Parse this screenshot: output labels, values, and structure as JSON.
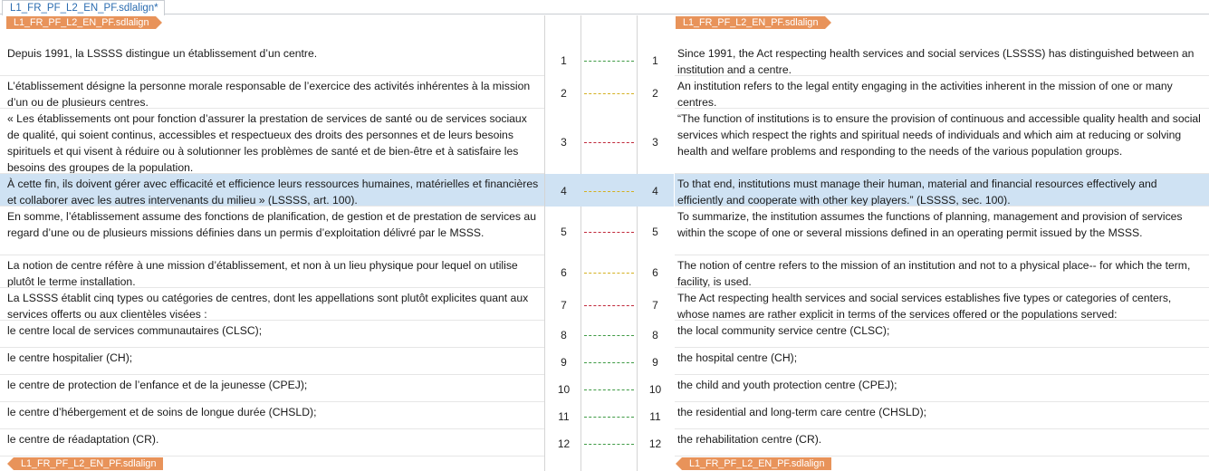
{
  "tab": {
    "label": "L1_FR_PF_L2_EN_PF.sdlalign*"
  },
  "files": {
    "source": "L1_FR_PF_L2_EN_PF.sdlalign",
    "target": "L1_FR_PF_L2_EN_PF.sdlalign"
  },
  "colors": {
    "green": "#3e9a44",
    "yellow": "#d4b020",
    "red": "#c0283a",
    "tag": "#e8935a",
    "selected": "#cfe2f3"
  },
  "segments": [
    {
      "n": "1",
      "quality": "green",
      "src": "Depuis 1991, la LSSSS distingue un établissement d’un centre.",
      "tgt": "Since 1991, the Act respecting health services and social services (LSSSS) has distinguished between an institution and a centre."
    },
    {
      "n": "2",
      "quality": "yellow",
      "src": "L’établissement désigne la personne morale responsable de l’exercice des activités inhérentes à la mission d’un ou de plusieurs centres.",
      "tgt": "An institution refers to the legal entity engaging in the activities inherent in the mission of one or many centres."
    },
    {
      "n": "3",
      "quality": "red",
      "src": "« Les établissements ont pour fonction d’assurer la prestation de services de santé ou de  services sociaux de qualité, qui soient continus, accessibles et respectueux des  droits des personnes et de leurs besoins spirituels et qui visent à réduire ou à solutionner les problèmes de santé et de bien-être et à satisfaire les besoins des groupes de la population.",
      "tgt": "“The function of institutions is to ensure the provision of continuous and accessible quality health and social services which respect the rights and spiritual needs of individuals and which aim at reducing or solving health and welfare problems and responding to the needs of the various population groups."
    },
    {
      "n": "4",
      "quality": "yellow",
      "selected": true,
      "src": "À cette fin, ils doivent gérer avec efficacité et efficience leurs ressources humaines, matérielles et financières et collaborer avec les autres intervenants du milieu » (LSSSS, art. 100).",
      "tgt": "To that end, institutions must manage their human, material and financial resources effectively and efficiently and cooperate with other key players.” (LSSSS, sec. 100)."
    },
    {
      "n": "5",
      "quality": "red",
      "src": "En somme, l’établissement assume des fonctions de planification, de gestion et de prestation de services au regard d’une ou de plusieurs missions définies dans un permis d’exploitation délivré par le MSSS.",
      "tgt": "To summarize, the institution assumes the functions of planning, management and provision of services within the scope of one or several missions defined in an operating permit issued by the MSSS."
    },
    {
      "n": "6",
      "quality": "yellow",
      "src": "La notion de centre réfère à une mission d’établissement, et non à un lieu physique pour lequel on utilise plutôt le terme installation.",
      "tgt": "The notion of centre refers to the mission of an institution and not to a physical place-- for which the term, facility, is used."
    },
    {
      "n": "7",
      "quality": "red",
      "src": "La LSSSS établit cinq types ou catégories de centres, dont les appellations sont plutôt explicites quant aux services offerts ou aux clientèles visées :",
      "tgt": "The Act respecting health services and social services establishes five types or categories of centers, whose names are rather explicit in terms of the services offered or the populations served:"
    },
    {
      "n": "8",
      "quality": "green",
      "src": "le centre local de services communautaires (CLSC);",
      "tgt": "the local community service centre (CLSC);"
    },
    {
      "n": "9",
      "quality": "green",
      "src": "le centre hospitalier (CH);",
      "tgt": "the hospital centre (CH);"
    },
    {
      "n": "10",
      "quality": "green",
      "src": "le centre de protection de l’enfance et de la jeunesse (CPEJ);",
      "tgt": "the child and youth protection centre (CPEJ);"
    },
    {
      "n": "11",
      "quality": "green",
      "src": "le centre d’hébergement et de soins de longue durée (CHSLD);",
      "tgt": "the residential and long-term care centre (CHSLD);"
    },
    {
      "n": "12",
      "quality": "green",
      "src": "le centre de réadaptation (CR).",
      "tgt": "the rehabilitation centre (CR)."
    }
  ]
}
